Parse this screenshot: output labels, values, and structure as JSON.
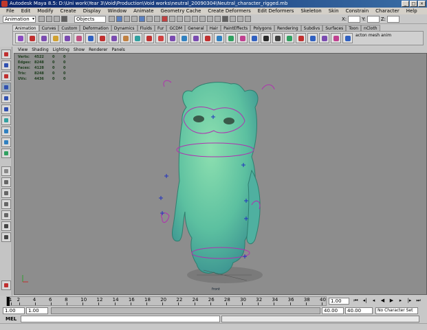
{
  "window": {
    "title": "Autodesk Maya 8.5: D:\\Uni work\\Year 3\\Void\\Production\\Void works\\neutral_20090304\\Neutral_character_rigged.mb",
    "minimize": "_",
    "maximize": "□",
    "close": "×"
  },
  "menubar": [
    "File",
    "Edit",
    "Modify",
    "Create",
    "Display",
    "Window",
    "Animate",
    "Geometry Cache",
    "Create Deformers",
    "Edit Deformers",
    "Skeleton",
    "Skin",
    "Constrain",
    "Character",
    "Help"
  ],
  "statusline": {
    "mode": "Animation",
    "objects": "Objects",
    "x_label": "X:",
    "y_label": "Y:",
    "z_label": "Z:"
  },
  "shelf": {
    "tabs": [
      "Animation",
      "Curves",
      "Custom",
      "Deformation",
      "Dynamics",
      "Fluids",
      "Fur",
      "GCDM",
      "General",
      "Hair",
      "PaintEffects",
      "Polygons",
      "Rendering",
      "Subdivs",
      "Surfaces",
      "Toon",
      "nCloth"
    ],
    "active_tab": 0,
    "end_label": "acton mesh anim"
  },
  "panel_menu": [
    "View",
    "Shading",
    "Lighting",
    "Show",
    "Renderer",
    "Panels"
  ],
  "hud": [
    {
      "key": "Verts:",
      "value": "4522",
      "a": "0",
      "b": "0"
    },
    {
      "key": "Edges:",
      "value": "8248",
      "a": "0",
      "b": "0"
    },
    {
      "key": "Faces:",
      "value": "4128",
      "a": "0",
      "b": "0"
    },
    {
      "key": "Tris:",
      "value": "8248",
      "a": "0",
      "b": "0"
    },
    {
      "key": "UVs:",
      "value": "4436",
      "a": "0",
      "b": "0"
    }
  ],
  "viewport": {
    "camera_name": "front"
  },
  "timeslider": {
    "ticks": [
      "1",
      "2",
      "4",
      "6",
      "8",
      "10",
      "12",
      "14",
      "16",
      "18",
      "20",
      "22",
      "24",
      "26",
      "28",
      "30",
      "32",
      "34",
      "36",
      "38",
      "40"
    ],
    "current_frame": "1.00"
  },
  "rangeslider": {
    "start": "1.00",
    "playback_start": "1.00",
    "playback_end": "40.00",
    "end": "40.00",
    "character_set": "No Character Set"
  },
  "cmdline": {
    "label": "MEL"
  },
  "colors": {
    "viewport_bg": "#8d8d8d",
    "character_fill": "#6fcc98",
    "rig_curve": "#b030b0",
    "locator": "#2030c0"
  }
}
